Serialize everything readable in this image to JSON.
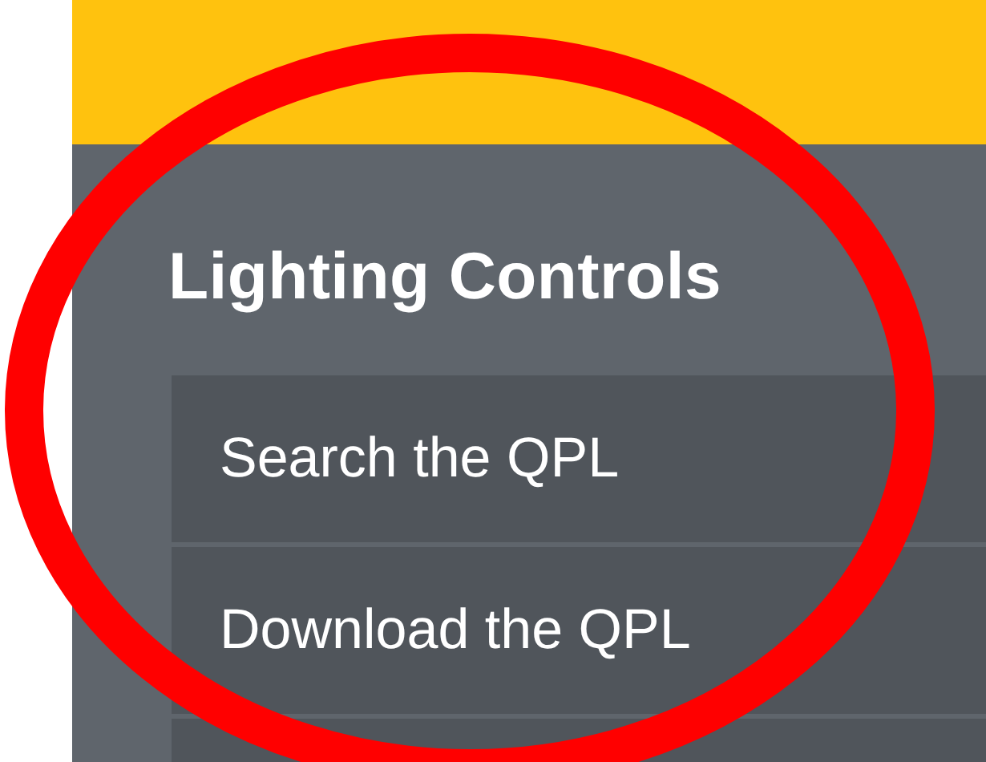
{
  "section": {
    "title": "Lighting Controls"
  },
  "menu": [
    {
      "kind": "link",
      "label": "Search the QPL"
    },
    {
      "kind": "link",
      "label": "Download the QPL"
    },
    {
      "kind": "cut"
    }
  ],
  "annotation": {
    "kind": "ellipse",
    "color": "#ff0000"
  }
}
